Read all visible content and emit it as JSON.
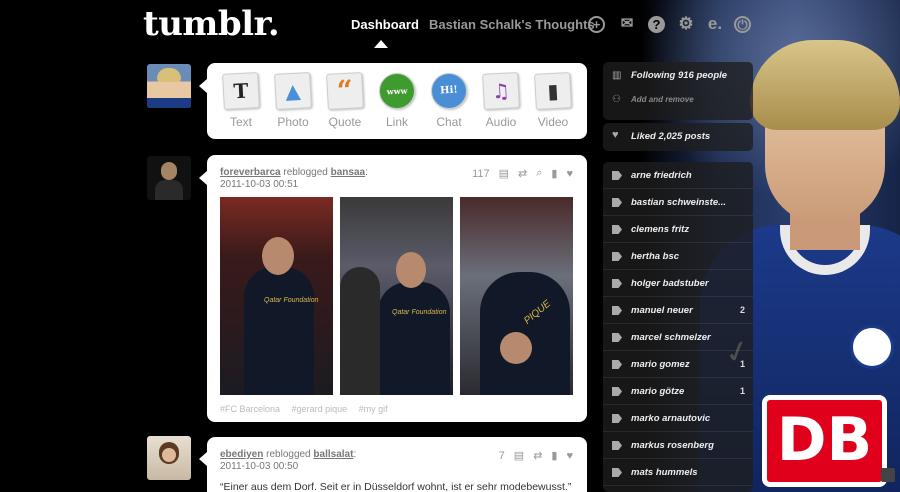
{
  "header": {
    "logo": "tumblr.",
    "nav_dashboard": "Dashboard",
    "nav_blog": "Bastian Schalk's Thoughts",
    "icons": [
      "plus-icon",
      "mail-icon",
      "help-icon",
      "gear-icon",
      "e-icon",
      "power-icon"
    ]
  },
  "composer": {
    "types": [
      {
        "label": "Text",
        "glyph": "T"
      },
      {
        "label": "Photo",
        "glyph": "▲"
      },
      {
        "label": "Quote",
        "glyph": "“"
      },
      {
        "label": "Link",
        "glyph": "www"
      },
      {
        "label": "Chat",
        "glyph": "Hi!"
      },
      {
        "label": "Audio",
        "glyph": "♫"
      },
      {
        "label": "Video",
        "glyph": "▮"
      }
    ]
  },
  "post1": {
    "user": "foreverbarca",
    "reblogged": "reblogged",
    "source": "bansaa",
    "timestamp": "2011-10-03 00:51",
    "notes": "117",
    "tags": [
      "#FC Barcelona",
      "#gerard pique",
      "#my gif"
    ],
    "gif_texts": [
      "Qatar Foundation",
      "Qatar Foundation",
      "PIQUE"
    ]
  },
  "post2": {
    "user": "ebediyen",
    "reblogged": "reblogged",
    "source": "ballsalat",
    "timestamp": "2011-10-03 00:50",
    "notes": "7",
    "quote": "“Einer aus dem Dorf. Seit er in Düsseldorf wohnt, ist er sehr modebewusst.”"
  },
  "sidebar": {
    "following": "Following 916 people",
    "add_remove": "Add and remove",
    "liked": "Liked 2,025 posts",
    "tracked_tags": [
      {
        "label": "arne friedrich",
        "count": ""
      },
      {
        "label": "bastian schweinste...",
        "count": ""
      },
      {
        "label": "clemens fritz",
        "count": ""
      },
      {
        "label": "hertha bsc",
        "count": ""
      },
      {
        "label": "holger badstuber",
        "count": ""
      },
      {
        "label": "manuel neuer",
        "count": "2"
      },
      {
        "label": "marcel schmelzer",
        "count": ""
      },
      {
        "label": "mario gomez",
        "count": "1"
      },
      {
        "label": "mario götze",
        "count": "1"
      },
      {
        "label": "marko arnautovic",
        "count": ""
      },
      {
        "label": "markus rosenberg",
        "count": ""
      },
      {
        "label": "mats hummels",
        "count": ""
      }
    ]
  },
  "background": {
    "sponsor": "DB"
  }
}
